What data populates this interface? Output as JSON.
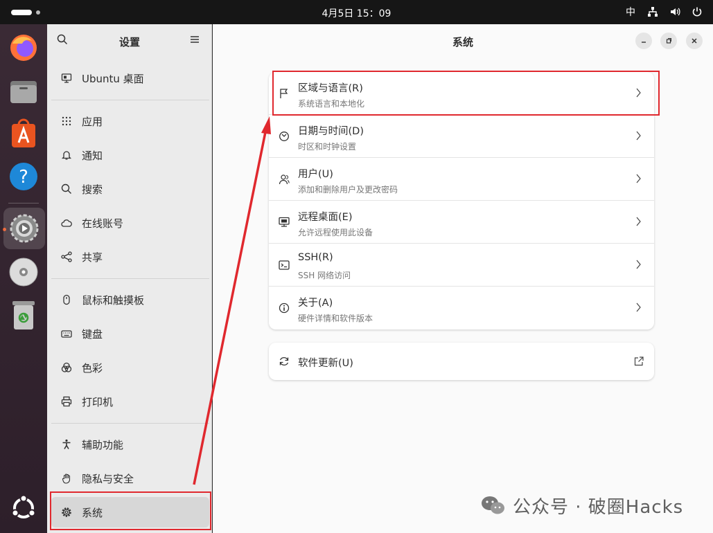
{
  "topbar": {
    "clock": "4月5日  15：09",
    "ime": "中"
  },
  "dock": {
    "apps": [
      "firefox-icon",
      "files-icon",
      "app-center-icon",
      "help-icon",
      "settings-icon",
      "disc-icon",
      "trash-icon",
      "ubuntu-menu-icon"
    ]
  },
  "sidebar": {
    "title": "设置",
    "items": [
      {
        "label": "Ubuntu 桌面",
        "icon": "desktop-icon"
      },
      {
        "label": "应用",
        "icon": "apps-grid-icon"
      },
      {
        "label": "通知",
        "icon": "bell-icon"
      },
      {
        "label": "搜索",
        "icon": "search-icon"
      },
      {
        "label": "在线账号",
        "icon": "cloud-icon"
      },
      {
        "label": "共享",
        "icon": "share-icon"
      },
      {
        "label": "鼠标和触摸板",
        "icon": "mouse-icon"
      },
      {
        "label": "键盘",
        "icon": "keyboard-icon"
      },
      {
        "label": "色彩",
        "icon": "color-icon"
      },
      {
        "label": "打印机",
        "icon": "printer-icon"
      },
      {
        "label": "辅助功能",
        "icon": "accessibility-icon"
      },
      {
        "label": "隐私与安全",
        "icon": "hand-icon"
      },
      {
        "label": "系统",
        "icon": "gear-icon"
      }
    ]
  },
  "main": {
    "title": "系统",
    "rows": [
      {
        "title": "区域与语言(R)",
        "subtitle": "系统语言和本地化",
        "icon": "flag-icon"
      },
      {
        "title": "日期与时间(D)",
        "subtitle": "时区和时钟设置",
        "icon": "clock-icon"
      },
      {
        "title": "用户(U)",
        "subtitle": "添加和删除用户及更改密码",
        "icon": "users-icon"
      },
      {
        "title": "远程桌面(E)",
        "subtitle": "允许远程使用此设备",
        "icon": "remote-desktop-icon"
      },
      {
        "title": "SSH(R)",
        "subtitle": "SSH 网络访问",
        "icon": "terminal-icon"
      },
      {
        "title": "关于(A)",
        "subtitle": "硬件详情和软件版本",
        "icon": "info-icon"
      }
    ],
    "update": {
      "title": "软件更新(U)",
      "icon": "refresh-icon"
    }
  },
  "watermark": {
    "text": "公众号 · 破圈Hacks"
  },
  "colors": {
    "highlight": "#e0282e",
    "accent": "#e95420"
  }
}
